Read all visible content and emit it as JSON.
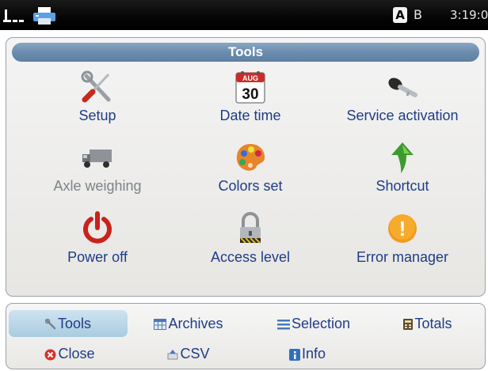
{
  "status": {
    "key_a": "A",
    "key_b": "B",
    "clock": "3:19:0"
  },
  "panel": {
    "title": "Tools",
    "tools": [
      {
        "label": "Setup",
        "icon": "wrench-screwdriver-icon",
        "enabled": true
      },
      {
        "label": "Date time",
        "icon": "calendar-icon",
        "enabled": true
      },
      {
        "label": "Service activation",
        "icon": "key-icon",
        "enabled": true
      },
      {
        "label": "Axle weighing",
        "icon": "truck-icon",
        "enabled": false
      },
      {
        "label": "Colors set",
        "icon": "palette-icon",
        "enabled": true
      },
      {
        "label": "Shortcut",
        "icon": "arrow-up-icon",
        "enabled": true
      },
      {
        "label": "Power off",
        "icon": "power-icon",
        "enabled": true
      },
      {
        "label": "Access level",
        "icon": "padlock-icon",
        "enabled": true
      },
      {
        "label": "Error manager",
        "icon": "warning-icon",
        "enabled": true
      }
    ],
    "calendar_month": "AUG",
    "calendar_day": "30",
    "warning_symbol": "!"
  },
  "nav": {
    "tools": "Tools",
    "archives": "Archives",
    "selection": "Selection",
    "totals": "Totals",
    "close": "Close",
    "csv": "CSV",
    "info": "Info",
    "active": "tools"
  },
  "colors": {
    "label_text": "#1f3c86",
    "disabled_text": "#7e8288",
    "title_bar": "#6b8cae",
    "active_nav": "#b7d4e6",
    "status_bar": "#000000"
  }
}
